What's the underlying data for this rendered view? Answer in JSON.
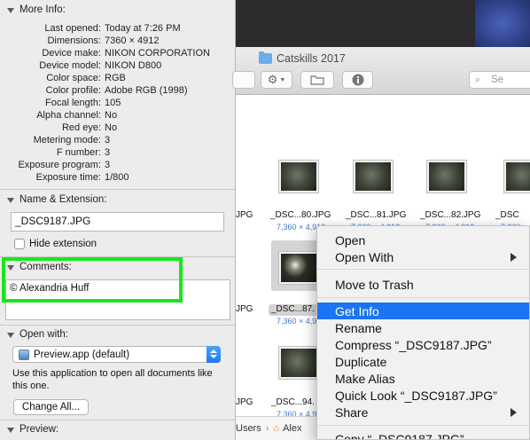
{
  "info_panel": {
    "more_info": {
      "header": "More Info:",
      "rows": [
        {
          "label": "Last opened:",
          "value": "Today at 7:26 PM"
        },
        {
          "label": "Dimensions:",
          "value": "7360 × 4912"
        },
        {
          "label": "Device make:",
          "value": "NIKON CORPORATION"
        },
        {
          "label": "Device model:",
          "value": "NIKON D800"
        },
        {
          "label": "Color space:",
          "value": "RGB"
        },
        {
          "label": "Color profile:",
          "value": "Adobe RGB (1998)"
        },
        {
          "label": "Focal length:",
          "value": "105"
        },
        {
          "label": "Alpha channel:",
          "value": "No"
        },
        {
          "label": "Red eye:",
          "value": "No"
        },
        {
          "label": "Metering mode:",
          "value": "3"
        },
        {
          "label": "F number:",
          "value": "3"
        },
        {
          "label": "Exposure program:",
          "value": "3"
        },
        {
          "label": "Exposure time:",
          "value": "1/800"
        }
      ]
    },
    "name_extension": {
      "header": "Name & Extension:",
      "filename": "_DSC9187.JPG",
      "hide_extension_label": "Hide extension"
    },
    "comments": {
      "header": "Comments:",
      "text": "© Alexandria Huff"
    },
    "open_with": {
      "header": "Open with:",
      "app": "Preview.app (default)",
      "description": "Use this application to open all documents like this one.",
      "change_all_label": "Change All..."
    },
    "preview": {
      "header": "Preview:"
    }
  },
  "finder": {
    "title": "Catskills 2017",
    "search_placeholder": "Se",
    "files_row1": [
      {
        "name": "JPG",
        "dims": ""
      },
      {
        "name": "_DSC...80.JPG",
        "dims": "7,360 × 4,912"
      },
      {
        "name": "_DSC...81.JPG",
        "dims": "7,360 × 4,912"
      },
      {
        "name": "_DSC...82.JPG",
        "dims": "7,360 × 4,912"
      },
      {
        "name": "_DSC",
        "dims": "7,360"
      }
    ],
    "files_row2": [
      {
        "name": "JPG",
        "dims": ""
      },
      {
        "name": "_DSC...87.",
        "dims": "7,360 × 4,912"
      }
    ],
    "files_row3": [
      {
        "name": "JPG",
        "dims": ""
      },
      {
        "name": "_DSC...94.",
        "dims": "7,360 × 4,9"
      }
    ],
    "path": {
      "users": "Users",
      "user": "Alex"
    }
  },
  "context_menu": {
    "open": "Open",
    "open_with": "Open With",
    "move_to_trash": "Move to Trash",
    "get_info": "Get Info",
    "rename": "Rename",
    "compress": "Compress “_DSC9187.JPG”",
    "duplicate": "Duplicate",
    "make_alias": "Make Alias",
    "quick_look": "Quick Look “_DSC9187.JPG”",
    "share": "Share",
    "copy": "Copy “_DSC9187.JPG”"
  },
  "colors": {
    "highlight_green": "#19e619",
    "menu_selection": "#1b74f2",
    "dimension_text": "#3f79d0"
  }
}
